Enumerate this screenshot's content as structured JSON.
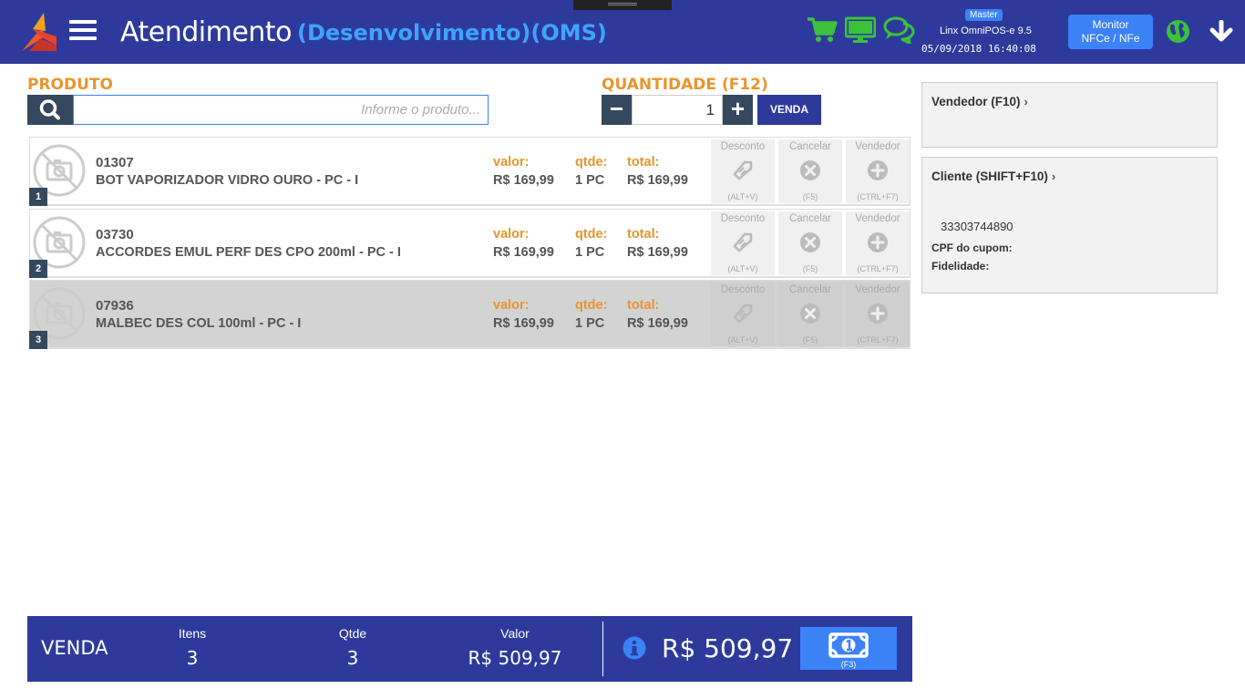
{
  "header": {
    "title": "Atendimento",
    "environment": "(Desenvolvimento)(OMS)",
    "badge": "Master",
    "app_version": "Linx OmniPOS-e  9.5",
    "datetime": "05/09/2018 16:40:08",
    "monitor_button_line1": "Monitor",
    "monitor_button_line2": "NFCe / NFe",
    "icons": [
      "logo",
      "menu-icon",
      "cart-icon",
      "monitor-icon",
      "chat-icon",
      "globe-icon",
      "download-icon"
    ],
    "colors": {
      "bar": "#2d3a9c",
      "env_text": "#3ea3ff",
      "icon_green": "#3cc13b",
      "accent_blue": "#3b82f6"
    }
  },
  "produto": {
    "label": "PRODUTO",
    "placeholder": "Informe o produto..."
  },
  "quantidade": {
    "label": "QUANTIDADE (F12)",
    "value": "1",
    "minus": "−",
    "plus": "+",
    "venda_button": "VENDA"
  },
  "field_labels": {
    "valor": "valor:",
    "qtde": "qtde:",
    "total": "total:"
  },
  "actions": {
    "desconto": {
      "label": "Desconto",
      "key": "(ALT+V)"
    },
    "cancelar": {
      "label": "Cancelar",
      "key": "(F5)"
    },
    "vendedor": {
      "label": "Vendedor",
      "key": "(CTRL+F7)"
    }
  },
  "items": [
    {
      "num": "1",
      "code": "01307",
      "desc": "BOT VAPORIZADOR VIDRO OURO - PC - I",
      "valor": "R$ 169,99",
      "qtde": "1 PC",
      "total": "R$ 169,99"
    },
    {
      "num": "2",
      "code": "03730",
      "desc": "ACCORDES EMUL PERF DES CPO 200ml - PC - I",
      "valor": "R$ 169,99",
      "qtde": "1 PC",
      "total": "R$ 169,99"
    },
    {
      "num": "3",
      "code": "07936",
      "desc": "MALBEC DES COL 100ml - PC - I",
      "valor": "R$ 169,99",
      "qtde": "1 PC",
      "total": "R$ 169,99"
    }
  ],
  "vendedor_panel": {
    "title": "Vendedor (F10)",
    "chevron": "›"
  },
  "cliente_panel": {
    "title": "Cliente (SHIFT+F10)",
    "chevron": "›",
    "document": "33303744890",
    "cpf_label": "CPF do cupom:",
    "fidelidade_label": "Fidelidade:"
  },
  "footer": {
    "venda_label": "VENDA",
    "itens_label": "Itens",
    "itens_value": "3",
    "qtde_label": "Qtde",
    "qtde_value": "3",
    "valor_label": "Valor",
    "valor_value": "R$ 509,97",
    "total": "R$ 509,97",
    "pay_key": "(F3)"
  }
}
